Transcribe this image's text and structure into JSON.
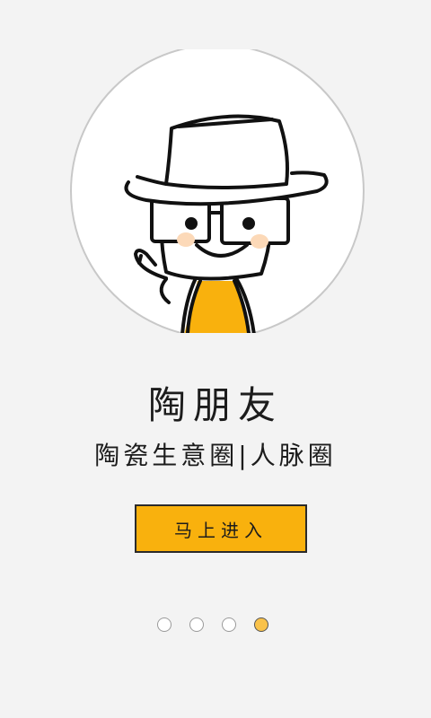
{
  "app": {
    "title": "陶朋友",
    "tagline": "陶瓷生意圈|人脉圈"
  },
  "actions": {
    "enter_label": "马上进入"
  },
  "pager": {
    "page_count": 4,
    "active_index": 3
  },
  "illustration": {
    "icon": "cartoon-character-avatar-icon",
    "accent_color": "#f9b10d"
  },
  "colors": {
    "background": "#f3f3f3",
    "button": "#f9b10d",
    "text": "#1c1c1c"
  }
}
